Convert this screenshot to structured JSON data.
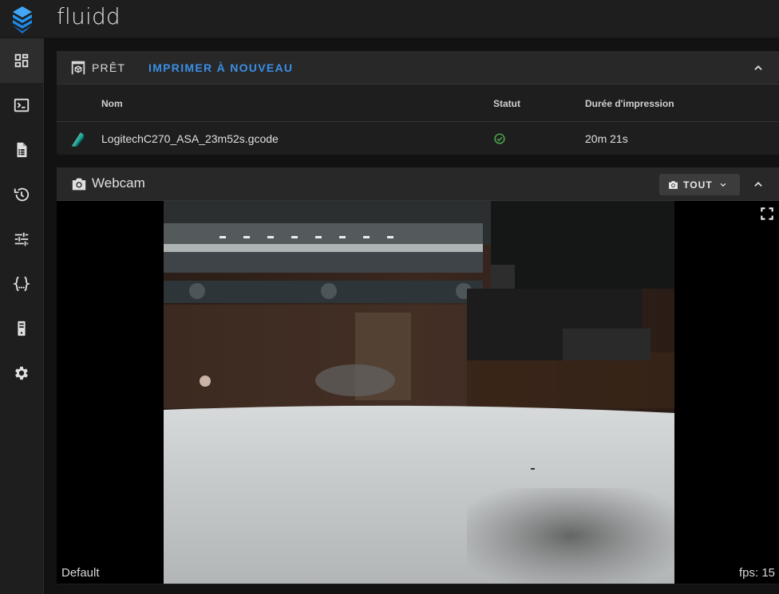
{
  "app": {
    "title": "fluidd"
  },
  "sidebar": {
    "items": [
      {
        "icon": "dashboard-icon",
        "active": true
      },
      {
        "icon": "console-icon",
        "active": false
      },
      {
        "icon": "jobs-file-icon",
        "active": false
      },
      {
        "icon": "history-icon",
        "active": false
      },
      {
        "icon": "tune-icon",
        "active": false
      },
      {
        "icon": "config-braces-icon",
        "active": false
      },
      {
        "icon": "system-icon",
        "active": false
      },
      {
        "icon": "settings-gear-icon",
        "active": false
      }
    ]
  },
  "status_card": {
    "status_label": "PRÊT",
    "reprint_label": "IMPRIMER À NOUVEAU",
    "table": {
      "headers": {
        "name": "Nom",
        "status": "Statut",
        "duration": "Durée d'impression"
      },
      "rows": [
        {
          "name": "LogitechC270_ASA_23m52s.gcode",
          "status": "success",
          "duration": "20m 21s"
        }
      ]
    }
  },
  "webcam_card": {
    "title": "Webcam",
    "camera_select_label": "TOUT",
    "camera_name": "Default",
    "fps_label": "fps: 15"
  },
  "colors": {
    "accent": "#3a8ee6",
    "success": "#4caf50",
    "logo": "#2196f3",
    "file_icon": "#26a69a"
  }
}
